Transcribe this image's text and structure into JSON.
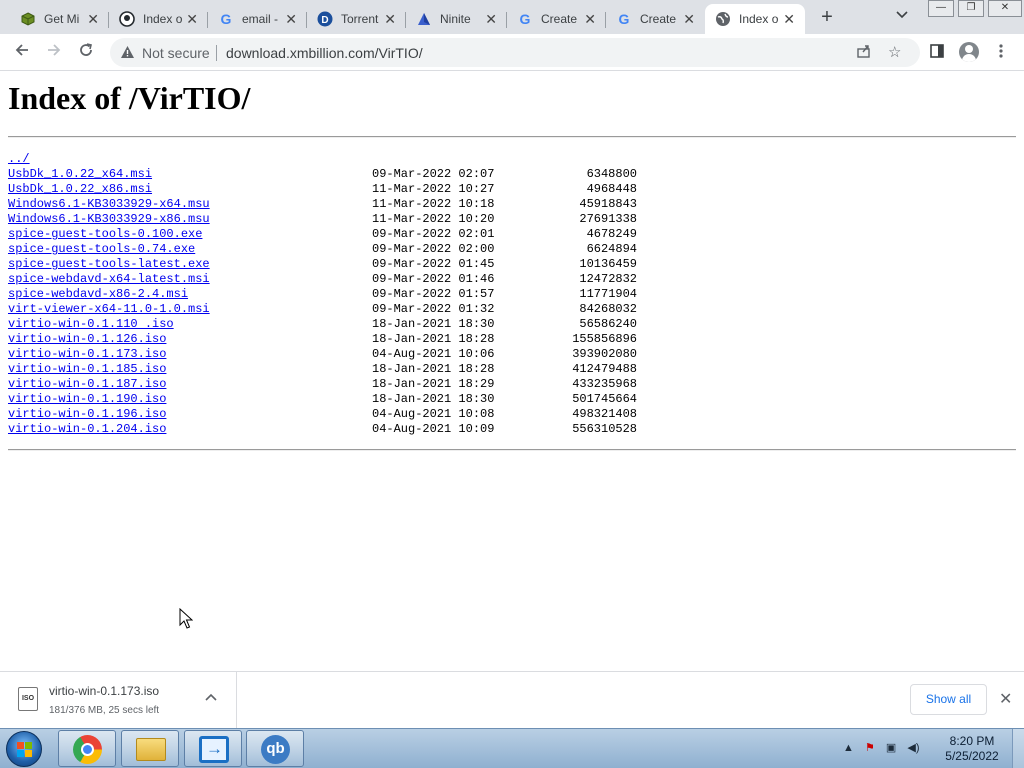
{
  "browser": {
    "tabs": [
      {
        "label": "Get Mi",
        "icon": "cube-icon"
      },
      {
        "label": "Index o",
        "icon": "github-icon"
      },
      {
        "label": "email -",
        "icon": "google-icon"
      },
      {
        "label": "Torrent",
        "icon": "torrent-icon"
      },
      {
        "label": "Ninite",
        "icon": "ninite-icon"
      },
      {
        "label": "Create",
        "icon": "google-icon"
      },
      {
        "label": "Create",
        "icon": "google-icon"
      },
      {
        "label": "Index o",
        "icon": "globe-icon",
        "active": true
      }
    ],
    "security_label": "Not secure",
    "url": "download.xmbillion.com/VirTIO/"
  },
  "page": {
    "title": "Index of /VirTIO/",
    "parent_link": "../",
    "files": [
      {
        "name": "UsbDk_1.0.22_x64.msi",
        "date": "09-Mar-2022 02:07",
        "size": "6348800"
      },
      {
        "name": "UsbDk_1.0.22_x86.msi",
        "date": "11-Mar-2022 10:27",
        "size": "4968448"
      },
      {
        "name": "Windows6.1-KB3033929-x64.msu",
        "date": "11-Mar-2022 10:18",
        "size": "45918843"
      },
      {
        "name": "Windows6.1-KB3033929-x86.msu",
        "date": "11-Mar-2022 10:20",
        "size": "27691338"
      },
      {
        "name": "spice-guest-tools-0.100.exe",
        "date": "09-Mar-2022 02:01",
        "size": "4678249"
      },
      {
        "name": "spice-guest-tools-0.74.exe",
        "date": "09-Mar-2022 02:00",
        "size": "6624894"
      },
      {
        "name": "spice-guest-tools-latest.exe",
        "date": "09-Mar-2022 01:45",
        "size": "10136459"
      },
      {
        "name": "spice-webdavd-x64-latest.msi",
        "date": "09-Mar-2022 01:46",
        "size": "12472832"
      },
      {
        "name": "spice-webdavd-x86-2.4.msi",
        "date": "09-Mar-2022 01:57",
        "size": "11771904"
      },
      {
        "name": "virt-viewer-x64-11.0-1.0.msi",
        "date": "09-Mar-2022 01:32",
        "size": "84268032"
      },
      {
        "name": "virtio-win-0.1.110 .iso",
        "date": "18-Jan-2021 18:30",
        "size": "56586240"
      },
      {
        "name": "virtio-win-0.1.126.iso",
        "date": "18-Jan-2021 18:28",
        "size": "155856896"
      },
      {
        "name": "virtio-win-0.1.173.iso",
        "date": "04-Aug-2021 10:06",
        "size": "393902080"
      },
      {
        "name": "virtio-win-0.1.185.iso",
        "date": "18-Jan-2021 18:28",
        "size": "412479488"
      },
      {
        "name": "virtio-win-0.1.187.iso",
        "date": "18-Jan-2021 18:29",
        "size": "433235968"
      },
      {
        "name": "virtio-win-0.1.190.iso",
        "date": "18-Jan-2021 18:30",
        "size": "501745664"
      },
      {
        "name": "virtio-win-0.1.196.iso",
        "date": "04-Aug-2021 10:08",
        "size": "498321408"
      },
      {
        "name": "virtio-win-0.1.204.iso",
        "date": "04-Aug-2021 10:09",
        "size": "556310528"
      }
    ]
  },
  "download_shelf": {
    "file_name": "virtio-win-0.1.173.iso",
    "file_icon_text": "ISO",
    "status": "181/376 MB, 25 secs left",
    "show_all_label": "Show all"
  },
  "taskbar": {
    "apps": [
      "chrome-icon",
      "file-explorer-icon",
      "remote-app-icon",
      "qbittorrent-icon"
    ],
    "qb_label": "qb",
    "time": "8:20 PM",
    "date": "5/25/2022"
  },
  "colors": {
    "link": "#0000ee",
    "tabstrip": "#dee1e6",
    "show_all_text": "#1a73e8"
  }
}
